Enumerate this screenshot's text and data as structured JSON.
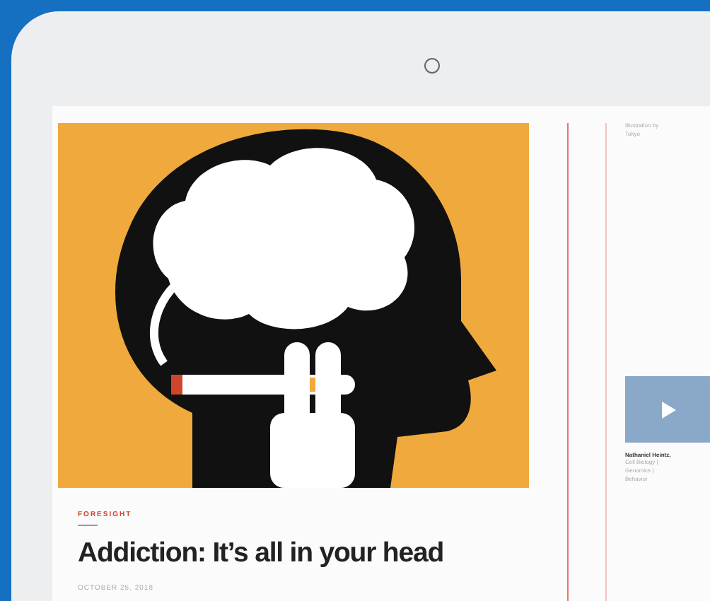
{
  "article": {
    "category": "FORESIGHT",
    "title": "Addiction: It’s all in your head",
    "date": "OCTOBER 25, 2018"
  },
  "sidebar": {
    "credit": "Illustration by",
    "credit_line_2": "Tokyo",
    "author": "Nathaniel Heintz,",
    "author_tags": "Cell Biology |",
    "author_tags_2": "Genomics |",
    "author_tags_3": "Behavior"
  }
}
